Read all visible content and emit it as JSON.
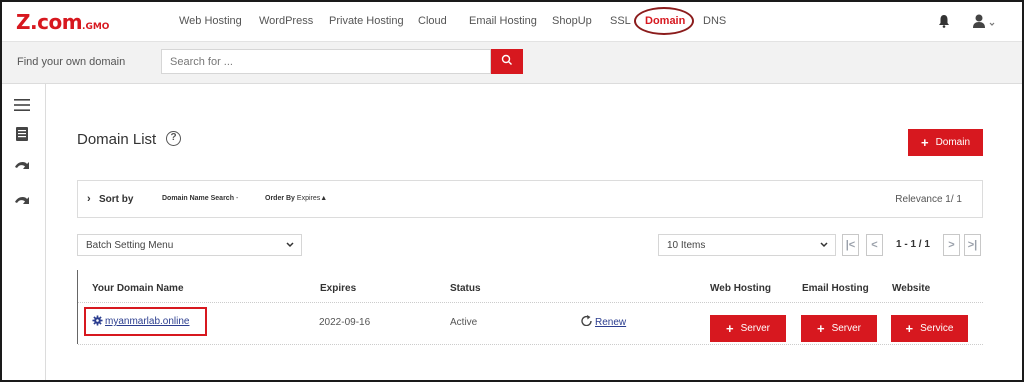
{
  "colors": {
    "accent": "#d7181f",
    "link": "#2b3d8f",
    "nav_highlight_ring": "#8b1c1c"
  },
  "header": {
    "logo_main": "Z.com",
    "logo_suffix": ".GMO",
    "nav": [
      "Web Hosting",
      "WordPress",
      "Private Hosting",
      "Cloud",
      "Email Hosting",
      "ShopUp",
      "SSL",
      "Domain",
      "DNS"
    ],
    "active_nav": "Domain",
    "icons": [
      "bell-icon",
      "user-icon"
    ]
  },
  "search": {
    "label": "Find your own domain",
    "placeholder": "Search for ...",
    "button_icon": "search-icon"
  },
  "sidebar": {
    "icons": [
      "menu-icon",
      "book-icon",
      "arrow-icon",
      "arrow-icon"
    ]
  },
  "main": {
    "title": "Domain List",
    "help_glyph": "?",
    "add_button": "Domain",
    "sort": {
      "label": "Sort by",
      "option1": "Domain Name Search",
      "option1_suffix": "-",
      "option2_label": "Order By",
      "option2_value": "Expires",
      "option2_arrow": "▲",
      "relevance": "Relevance 1/ 1"
    },
    "batch_menu": "Batch Setting Menu",
    "items_per_page": "10 Items",
    "pagination": {
      "first": "|<",
      "prev": "<",
      "info": "1 - 1 / 1",
      "next": ">",
      "last": ">|"
    },
    "table": {
      "headers": {
        "name": "Your Domain Name",
        "expires": "Expires",
        "status": "Status",
        "web_hosting": "Web Hosting",
        "email_hosting": "Email Hosting",
        "website": "Website"
      },
      "rows": [
        {
          "domain": "myanmarlab.online",
          "expires": "2022-09-16",
          "status": "Active",
          "renew": "Renew",
          "web_hosting": "Server",
          "email_hosting": "Server",
          "website": "Service"
        }
      ]
    }
  }
}
